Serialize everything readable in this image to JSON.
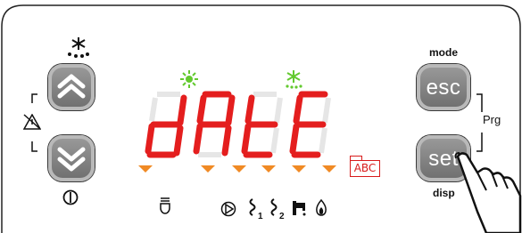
{
  "display": {
    "text": "dAtE",
    "digits": [
      "d",
      "A",
      "t",
      "E"
    ],
    "segment_color_on": "#e41e1e",
    "segment_color_off": "#e8e8e8",
    "decimal_indicator_color": "#f08a24"
  },
  "buttons": {
    "up": {
      "icon": "chevron-up-double"
    },
    "down": {
      "icon": "chevron-down-double"
    },
    "esc": {
      "label": "esc",
      "above_label": "mode"
    },
    "set": {
      "label": "set",
      "below_label": "disp"
    },
    "prg_label": "Prg"
  },
  "indicators": {
    "cooling_icon": "sun-icon",
    "defrost_icon": "snowflake-icon",
    "defrost_top_icon": "snowflake-drip-icon",
    "alarm_icon": "alarm-crossed-icon",
    "power_icon": "power-icon",
    "abc_label": "ABC"
  },
  "bottom_icons": {
    "light": "bell-light-icon",
    "compressor": "compressor-icon",
    "fan1": "fan-icon",
    "fan1_label": "1",
    "fan2": "fan-icon",
    "fan2_label": "2",
    "tap": "tap-icon",
    "flame": "flame-icon"
  },
  "colors": {
    "accent_green": "#63c92f",
    "button_gray": "#7f7f7f",
    "panel_border": "#222222"
  }
}
